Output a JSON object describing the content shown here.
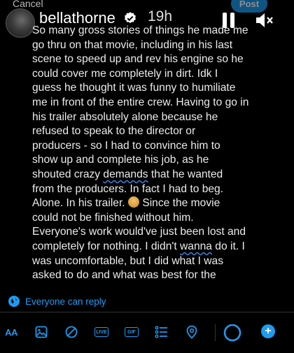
{
  "header": {
    "cancel_label": "Cancel",
    "post_label": "Post",
    "username": "bellathorne",
    "time": "19h"
  },
  "post": {
    "lines": [
      "So many gross stories of things he made me",
      "go thru on that movie, including in his last",
      "scene to speed up and rev his engine so he",
      "could cover me completely in dirt. Idk I",
      "guess he thought it was funny to humiliate",
      "me in front of the entire crew. Having to go in",
      "his trailer absolutely alone because he",
      "refused to speak to the director or",
      "producers - so I had to convince him to",
      "show up and complete his job, as he",
      "shouted crazy demands that he wanted",
      "from the producers. In fact I had to beg.",
      "Alone. In his trailer.",
      "Since the movie",
      "could not be finished without him.",
      "Everyone's work would've just been lost and",
      "completely for nothing. I didn't wanna do it. I",
      "was uncomfortable, but I did what I was",
      "asked to do and what was best for the"
    ],
    "misspelled": [
      "demands",
      "wanna"
    ]
  },
  "reply_setting": {
    "label": "Everyone can reply",
    "icon": "globe-icon"
  },
  "toolbar": {
    "text_size_label": "AA",
    "live_label": "LIVE",
    "gif_label": "GIF",
    "icons": [
      "text-size-icon",
      "image-icon",
      "draw-icon",
      "live-icon",
      "gif-icon",
      "poll-icon",
      "location-icon",
      "character-progress-icon",
      "add-post-icon"
    ]
  },
  "colors": {
    "accent": "#1d9bf0",
    "background": "#000000",
    "text": "#e7e9ea",
    "divider": "#2f3336"
  }
}
